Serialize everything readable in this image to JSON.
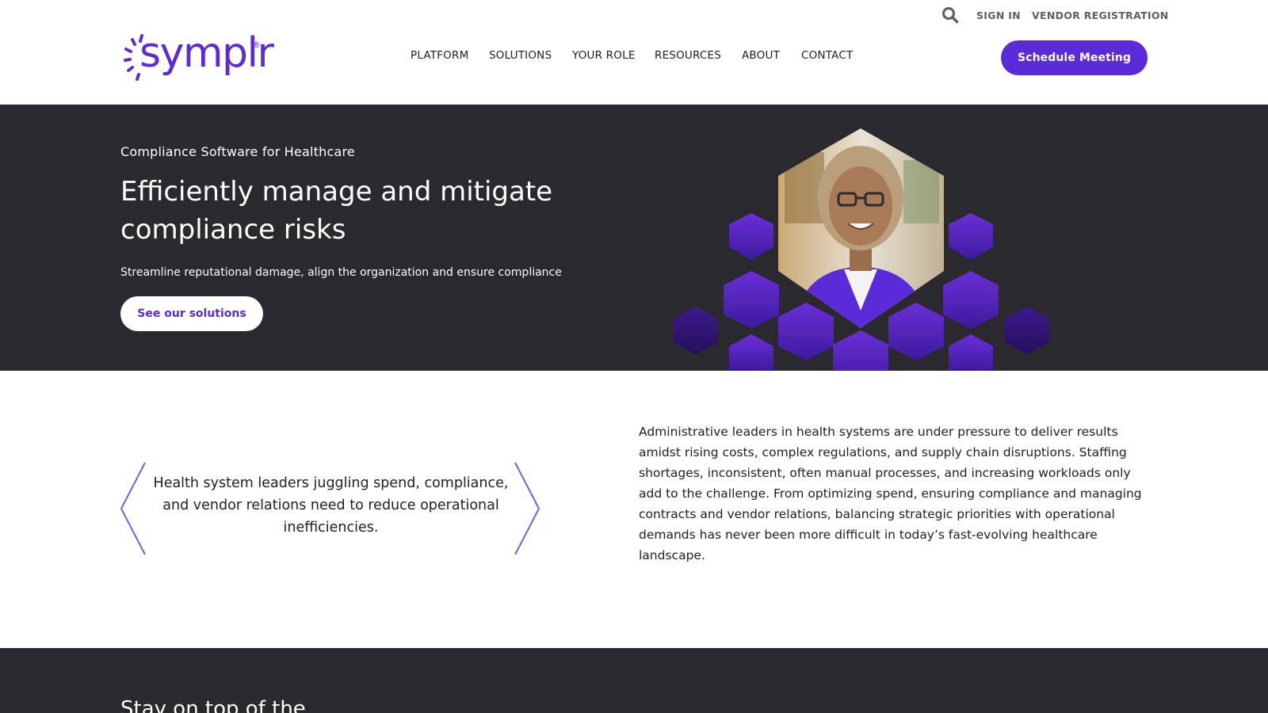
{
  "brand": {
    "name": "symplr",
    "reg_mark": "®",
    "color": "#5b2bd9"
  },
  "utility_nav": {
    "search_icon": "search-icon",
    "links": [
      "SIGN IN",
      "VENDOR REGISTRATION"
    ]
  },
  "main_nav": {
    "items": [
      "PLATFORM",
      "SOLUTIONS",
      "YOUR ROLE",
      "RESOURCES",
      "ABOUT",
      "CONTACT"
    ],
    "cta_label": "Schedule Meeting"
  },
  "hero": {
    "eyebrow": "Compliance Software for Healthcare",
    "title": "Efficiently manage and mitigate compliance risks",
    "subtitle": "Streamline reputational damage, align the organization and ensure compliance",
    "button_label": "See our solutions",
    "image": "woman-portrait-hexagon-image",
    "background_color": "#2a2a2e"
  },
  "statement": {
    "quote": "Health system leaders juggling spend, compliance, and vendor relations need to reduce operational inefficiencies.",
    "body": "Administrative leaders in health systems are under pressure to deliver results amidst rising costs, complex regulations, and supply chain disruptions. Staffing shortages, inconsistent, often manual processes, and increasing workloads only add to the challenge. From optimizing spend, ensuring compliance and managing contracts and vendor relations, balancing strategic priorities with operational demands has never been more difficult in today’s fast-evolving healthcare landscape."
  },
  "next_section": {
    "title_partial": "Stay on top of the"
  }
}
